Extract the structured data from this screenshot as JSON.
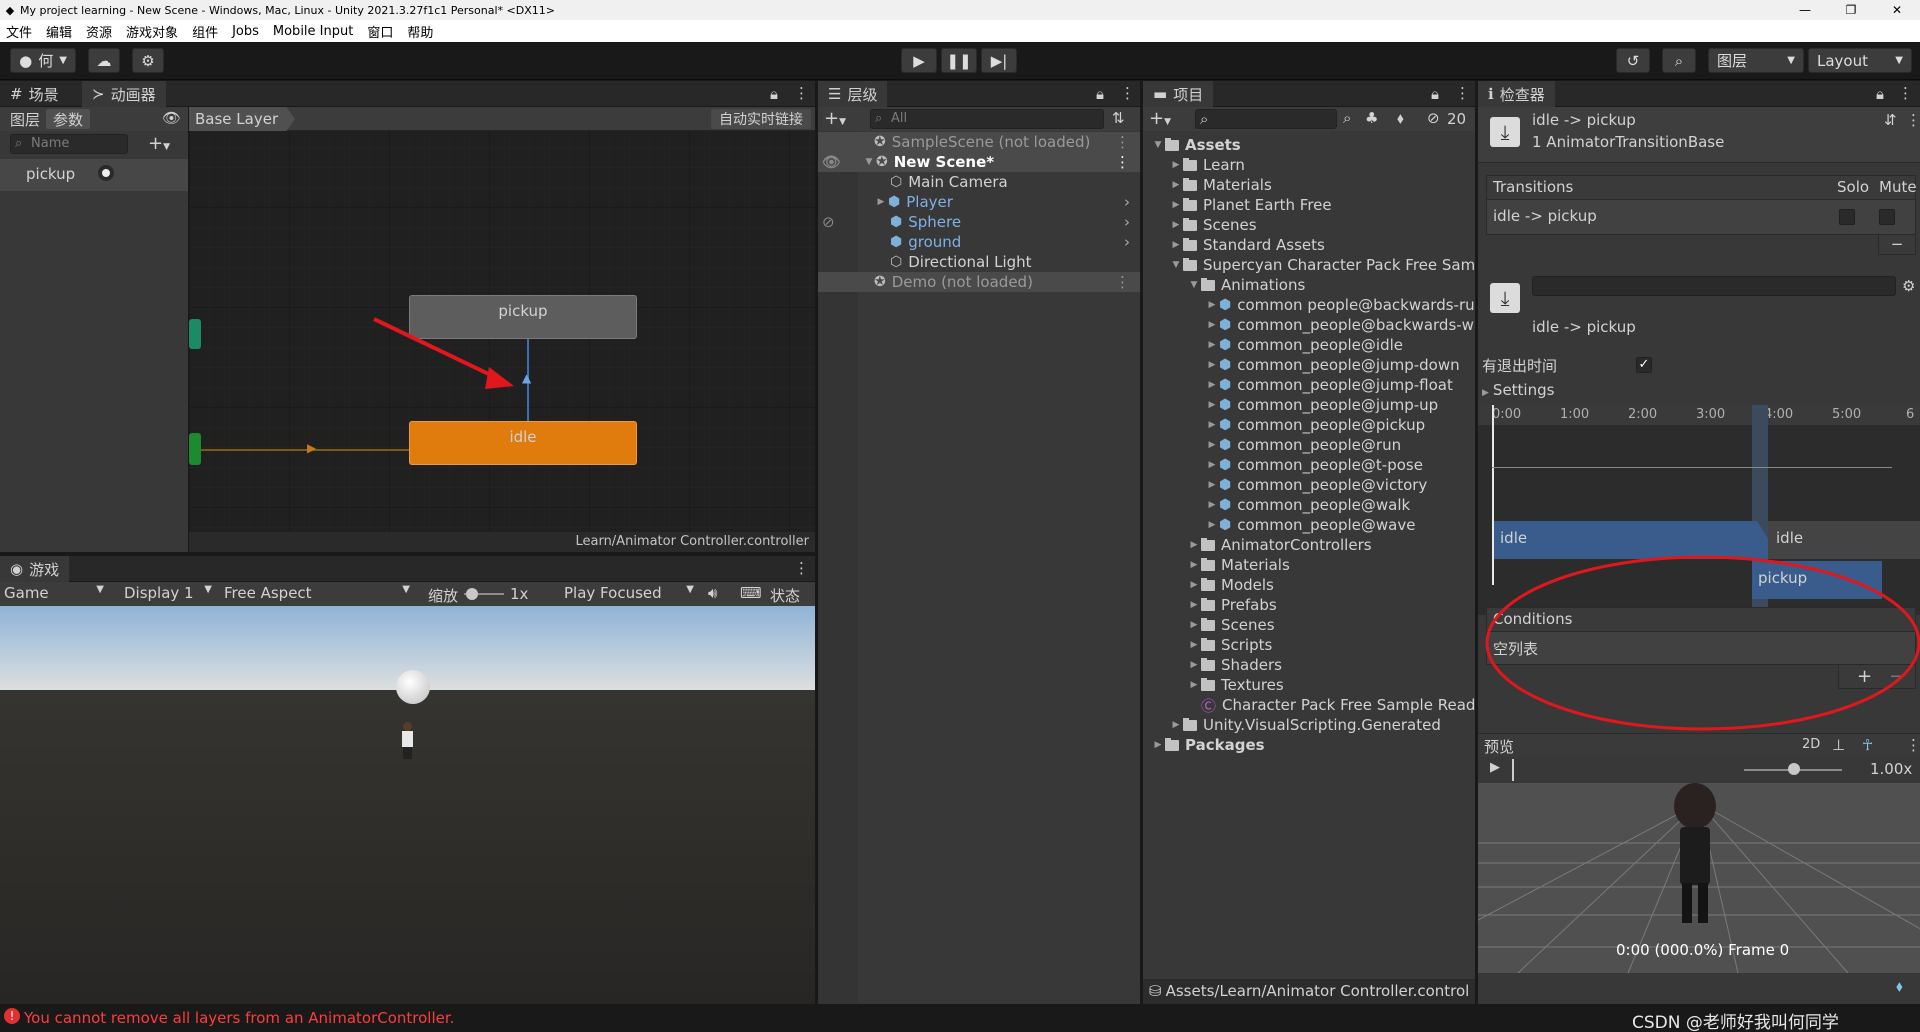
{
  "window": {
    "title": "My project learning - New Scene - Windows, Mac, Linux - Unity 2021.3.27f1c1 Personal* <DX11>"
  },
  "menu": [
    "文件",
    "编辑",
    "资源",
    "游戏对象",
    "组件",
    "Jobs",
    "Mobile Input",
    "窗口",
    "帮助"
  ],
  "toolbar": {
    "account": "何",
    "layers_label": "图层",
    "layout_label": "Layout"
  },
  "animator": {
    "tab_scene": "场景",
    "tab_animator": "动画器",
    "tab_layers": "图层",
    "tab_params": "参数",
    "search_placeholder": "Name",
    "breadcrumb": "Base Layer",
    "auto_live_link": "自动实时链接",
    "param_name": "pickup",
    "node_pickup": "pickup",
    "node_idle": "idle",
    "footer_path": "Learn/Animator Controller.controller"
  },
  "game": {
    "tab": "游戏",
    "display_mode": "Game",
    "display": "Display 1",
    "aspect": "Free Aspect",
    "scale_label": "缩放",
    "scale_value": "1x",
    "play_mode": "Play Focused",
    "stats": "状态"
  },
  "hierarchy": {
    "tab": "层级",
    "search_placeholder": "All",
    "items": [
      {
        "label": "SampleScene (not loaded)"
      },
      {
        "label": "New Scene*"
      },
      {
        "label": "Main Camera"
      },
      {
        "label": "Player"
      },
      {
        "label": "Sphere"
      },
      {
        "label": "ground"
      },
      {
        "label": "Directional Light"
      },
      {
        "label": "Demo (not loaded)"
      }
    ]
  },
  "project": {
    "tab": "项目",
    "hidden_count": "20",
    "items": [
      "Assets",
      "Learn",
      "Materials",
      "Planet Earth Free",
      "Scenes",
      "Standard Assets",
      "Supercyan Character Pack Free Samp",
      "Animations",
      "common people@backwards-ru",
      "common_people@backwards-wa",
      "common_people@idle",
      "common_people@jump-down",
      "common_people@jump-float",
      "common_people@jump-up",
      "common_people@pickup",
      "common_people@run",
      "common_people@t-pose",
      "common_people@victory",
      "common_people@walk",
      "common_people@wave",
      "AnimatorControllers",
      "Materials",
      "Models",
      "Prefabs",
      "Scenes",
      "Scripts",
      "Shaders",
      "Textures",
      "Character Pack Free Sample Readi",
      "Unity.VisualScripting.Generated",
      "Packages"
    ],
    "footer_path": "Assets/Learn/Animator Controller.control"
  },
  "inspector": {
    "tab": "检查器",
    "title": "idle -> pickup",
    "subtitle": "1 AnimatorTransitionBase",
    "transitions_label": "Transitions",
    "solo_label": "Solo",
    "mute_label": "Mute",
    "transition_row": "idle -> pickup",
    "transition_name": "idle -> pickup",
    "has_exit_time_label": "有退出时间",
    "has_exit_time": true,
    "settings_label": "Settings",
    "timeline_ticks": [
      "0:00",
      "1:00",
      "2:00",
      "3:00",
      "4:00",
      "5:00",
      "6"
    ],
    "timeline_idle_1": "idle",
    "timeline_idle_2": "idle",
    "timeline_pickup": "pickup",
    "conditions_label": "Conditions",
    "conditions_empty": "空列表",
    "preview_label": "预览",
    "preview_2d": "2D",
    "preview_speed": "1.00x",
    "preview_frame": "0:00 (000.0%) Frame 0"
  },
  "status": {
    "error": "You cannot remove all layers from an AnimatorController.",
    "watermark": "CSDN @老师好我叫何同学"
  },
  "colors": {
    "idle_node": "#e07b0e",
    "pickup_node": "#5d5d5d",
    "error_text": "#ff3c3c",
    "annotation_red": "#e0181d",
    "timeline_blue": "#3a5c8c"
  }
}
